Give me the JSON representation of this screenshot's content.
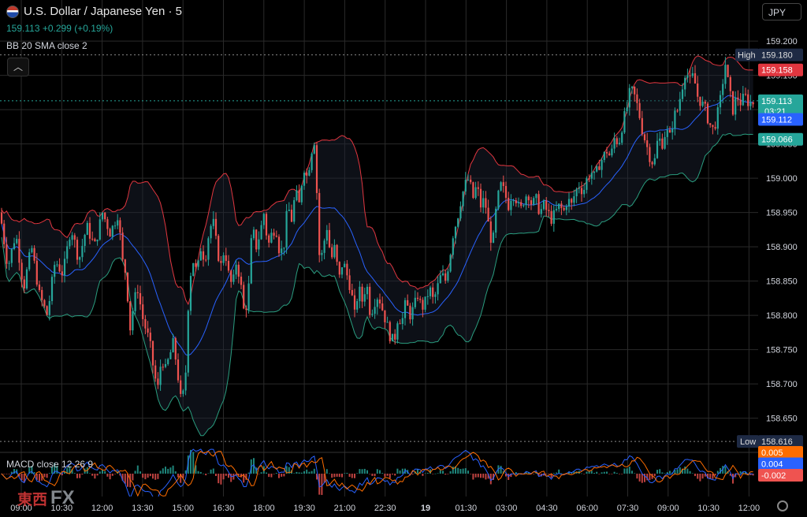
{
  "header": {
    "title": "U.S. Dollar / Japanese Yen · 5",
    "quote": "159.113 +0.299 (+0.19%)",
    "indicator": "BB 20 SMA close 2",
    "collapse_icon": "chevron-up-icon"
  },
  "currency": "JPY",
  "macd_label": "MACD close 12 26 9",
  "logo": {
    "jp": "東西",
    "fx": "FX"
  },
  "price_labels": {
    "high_tag": "High",
    "high": "159.180",
    "upper": "159.158",
    "last": "159.113",
    "countdown": "03:21",
    "middle": "159.112",
    "lower": "159.066",
    "low_tag": "Low",
    "low": "158.616"
  },
  "macd_labels": [
    "0.005",
    "0.004",
    "-0.002"
  ],
  "colors": {
    "up": "#26a69a",
    "down": "#ef5350",
    "bb_upper": "#e0363f",
    "bb_lower": "#2a9d7f",
    "bb_mid": "#2962ff",
    "grid": "#2a2a2a",
    "macd_line": "#2962ff",
    "signal_line": "#ff6d00"
  },
  "chart_data": {
    "type": "candlestick",
    "title": "U.S. Dollar / Japanese Yen · 5",
    "y_ticks": [
      158.65,
      158.7,
      158.75,
      158.8,
      158.85,
      158.9,
      158.95,
      159.0,
      159.05,
      159.1,
      159.15,
      159.2
    ],
    "ylim": [
      158.607,
      159.214
    ],
    "x_ticks": [
      "09:00",
      "10:30",
      "12:00",
      "13:30",
      "15:00",
      "16:30",
      "18:00",
      "19:30",
      "21:00",
      "22:30",
      "19",
      "01:30",
      "03:00",
      "04:30",
      "06:00",
      "07:30",
      "09:00",
      "10:30",
      "12:00"
    ],
    "close_path": [
      [
        0,
        158.95
      ],
      [
        10,
        158.87
      ],
      [
        20,
        158.92
      ],
      [
        30,
        158.84
      ],
      [
        40,
        158.9
      ],
      [
        50,
        158.83
      ],
      [
        60,
        158.8
      ],
      [
        70,
        158.88
      ],
      [
        80,
        158.86
      ],
      [
        90,
        158.93
      ],
      [
        100,
        158.88
      ],
      [
        110,
        158.93
      ],
      [
        120,
        158.9
      ],
      [
        130,
        158.95
      ],
      [
        140,
        158.92
      ],
      [
        150,
        158.95
      ],
      [
        155,
        158.88
      ],
      [
        160,
        158.86
      ],
      [
        165,
        158.78
      ],
      [
        170,
        158.82
      ],
      [
        175,
        158.84
      ],
      [
        180,
        158.8
      ],
      [
        185,
        158.78
      ],
      [
        190,
        158.76
      ],
      [
        195,
        158.72
      ],
      [
        200,
        158.69
      ],
      [
        205,
        158.74
      ],
      [
        210,
        158.72
      ],
      [
        215,
        158.74
      ],
      [
        220,
        158.76
      ],
      [
        225,
        158.72
      ],
      [
        230,
        158.67
      ],
      [
        235,
        158.7
      ],
      [
        240,
        158.85
      ],
      [
        245,
        158.88
      ],
      [
        250,
        158.86
      ],
      [
        255,
        158.9
      ],
      [
        260,
        158.88
      ],
      [
        265,
        158.92
      ],
      [
        270,
        158.94
      ],
      [
        275,
        158.9
      ],
      [
        280,
        158.87
      ],
      [
        285,
        158.9
      ],
      [
        290,
        158.86
      ],
      [
        295,
        158.84
      ],
      [
        300,
        158.88
      ],
      [
        305,
        158.85
      ],
      [
        310,
        158.8
      ],
      [
        315,
        158.83
      ],
      [
        320,
        158.93
      ],
      [
        325,
        158.9
      ],
      [
        330,
        158.92
      ],
      [
        335,
        158.95
      ],
      [
        340,
        158.9
      ],
      [
        345,
        158.92
      ],
      [
        350,
        158.93
      ],
      [
        355,
        158.89
      ],
      [
        360,
        158.9
      ],
      [
        365,
        158.96
      ],
      [
        370,
        158.94
      ],
      [
        375,
        158.98
      ],
      [
        380,
        158.96
      ],
      [
        385,
        159.02
      ],
      [
        390,
        159.0
      ],
      [
        395,
        159.04
      ],
      [
        400,
        159.06
      ],
      [
        403,
        158.94
      ],
      [
        406,
        158.87
      ],
      [
        410,
        158.9
      ],
      [
        415,
        158.93
      ],
      [
        420,
        158.88
      ],
      [
        425,
        158.9
      ],
      [
        430,
        158.85
      ],
      [
        435,
        158.88
      ],
      [
        440,
        158.86
      ],
      [
        445,
        158.84
      ],
      [
        450,
        158.8
      ],
      [
        455,
        158.84
      ],
      [
        460,
        158.82
      ],
      [
        465,
        158.85
      ],
      [
        470,
        158.8
      ],
      [
        475,
        158.82
      ],
      [
        480,
        158.83
      ],
      [
        485,
        158.81
      ],
      [
        490,
        158.79
      ],
      [
        495,
        158.77
      ],
      [
        500,
        158.76
      ],
      [
        505,
        158.8
      ],
      [
        510,
        158.79
      ],
      [
        515,
        158.82
      ],
      [
        520,
        158.8
      ],
      [
        525,
        158.81
      ],
      [
        530,
        158.83
      ],
      [
        535,
        158.81
      ],
      [
        540,
        158.82
      ],
      [
        545,
        158.84
      ],
      [
        550,
        158.82
      ],
      [
        555,
        158.84
      ],
      [
        560,
        158.86
      ],
      [
        565,
        158.85
      ],
      [
        570,
        158.88
      ],
      [
        575,
        158.92
      ],
      [
        580,
        158.94
      ],
      [
        585,
        158.97
      ],
      [
        590,
        158.99
      ],
      [
        595,
        159.0
      ],
      [
        600,
        158.97
      ],
      [
        605,
        158.99
      ],
      [
        610,
        158.96
      ],
      [
        615,
        158.97
      ],
      [
        620,
        158.93
      ],
      [
        625,
        158.9
      ],
      [
        630,
        158.96
      ],
      [
        635,
        158.99
      ],
      [
        640,
        158.98
      ],
      [
        645,
        158.96
      ],
      [
        650,
        158.98
      ],
      [
        655,
        158.97
      ],
      [
        660,
        158.95
      ],
      [
        665,
        158.97
      ],
      [
        670,
        158.98
      ],
      [
        675,
        158.96
      ],
      [
        680,
        158.97
      ],
      [
        685,
        158.95
      ],
      [
        690,
        158.96
      ],
      [
        695,
        158.95
      ],
      [
        700,
        158.94
      ],
      [
        705,
        158.95
      ],
      [
        710,
        158.96
      ],
      [
        715,
        158.95
      ],
      [
        720,
        158.97
      ],
      [
        725,
        158.96
      ],
      [
        730,
        158.98
      ],
      [
        735,
        158.99
      ],
      [
        740,
        158.98
      ],
      [
        745,
        159.0
      ],
      [
        750,
        159.01
      ],
      [
        755,
        159.0
      ],
      [
        760,
        159.02
      ],
      [
        765,
        159.03
      ],
      [
        770,
        159.04
      ],
      [
        775,
        159.03
      ],
      [
        780,
        159.06
      ],
      [
        785,
        159.05
      ],
      [
        790,
        159.08
      ],
      [
        795,
        159.1
      ],
      [
        800,
        159.13
      ],
      [
        805,
        159.12
      ],
      [
        810,
        159.1
      ],
      [
        815,
        159.07
      ],
      [
        820,
        159.05
      ],
      [
        825,
        159.03
      ],
      [
        830,
        159.02
      ],
      [
        835,
        159.06
      ],
      [
        840,
        159.05
      ],
      [
        845,
        159.07
      ],
      [
        850,
        159.06
      ],
      [
        855,
        159.09
      ],
      [
        860,
        159.1
      ],
      [
        865,
        159.13
      ],
      [
        870,
        159.16
      ],
      [
        875,
        159.14
      ],
      [
        880,
        159.15
      ],
      [
        885,
        159.12
      ],
      [
        890,
        159.11
      ],
      [
        895,
        159.1
      ],
      [
        900,
        159.08
      ],
      [
        905,
        159.07
      ],
      [
        910,
        159.09
      ],
      [
        915,
        159.12
      ],
      [
        920,
        159.17
      ],
      [
        925,
        159.13
      ],
      [
        930,
        159.1
      ],
      [
        935,
        159.12
      ],
      [
        940,
        159.11
      ],
      [
        945,
        159.12
      ],
      [
        950,
        159.11
      ],
      [
        955,
        159.11
      ],
      [
        960,
        159.113
      ]
    ]
  }
}
